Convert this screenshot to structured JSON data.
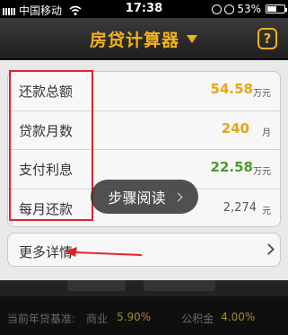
{
  "status_bar": {
    "carrier": "中国移动",
    "time": "17:38",
    "battery": "53%",
    "battery_level": 0.53
  },
  "nav": {
    "title": "房贷计算器"
  },
  "results": [
    {
      "label": "还款总额",
      "value": "54.58",
      "unit": "万元"
    },
    {
      "label": "贷款月数",
      "value": "240",
      "unit": "月"
    },
    {
      "label": "支付利息",
      "value": "22.58",
      "unit": "万元"
    },
    {
      "label": "每月还款",
      "value": "2,274",
      "unit": "元"
    }
  ],
  "detail": {
    "label": "更多详情"
  },
  "toast": {
    "label": "步骤阅读"
  },
  "bottom": {
    "prefix": "当前年贷基准:",
    "commercial_label": "商业",
    "commercial_rate": "5.90%",
    "fund_label": "公积金",
    "fund_rate": "4.00%"
  },
  "colors": {
    "accent": "#f3b21b",
    "orange_value": "#e8a513",
    "green_value": "#4a9a2b",
    "annotation": "#e0242a"
  }
}
